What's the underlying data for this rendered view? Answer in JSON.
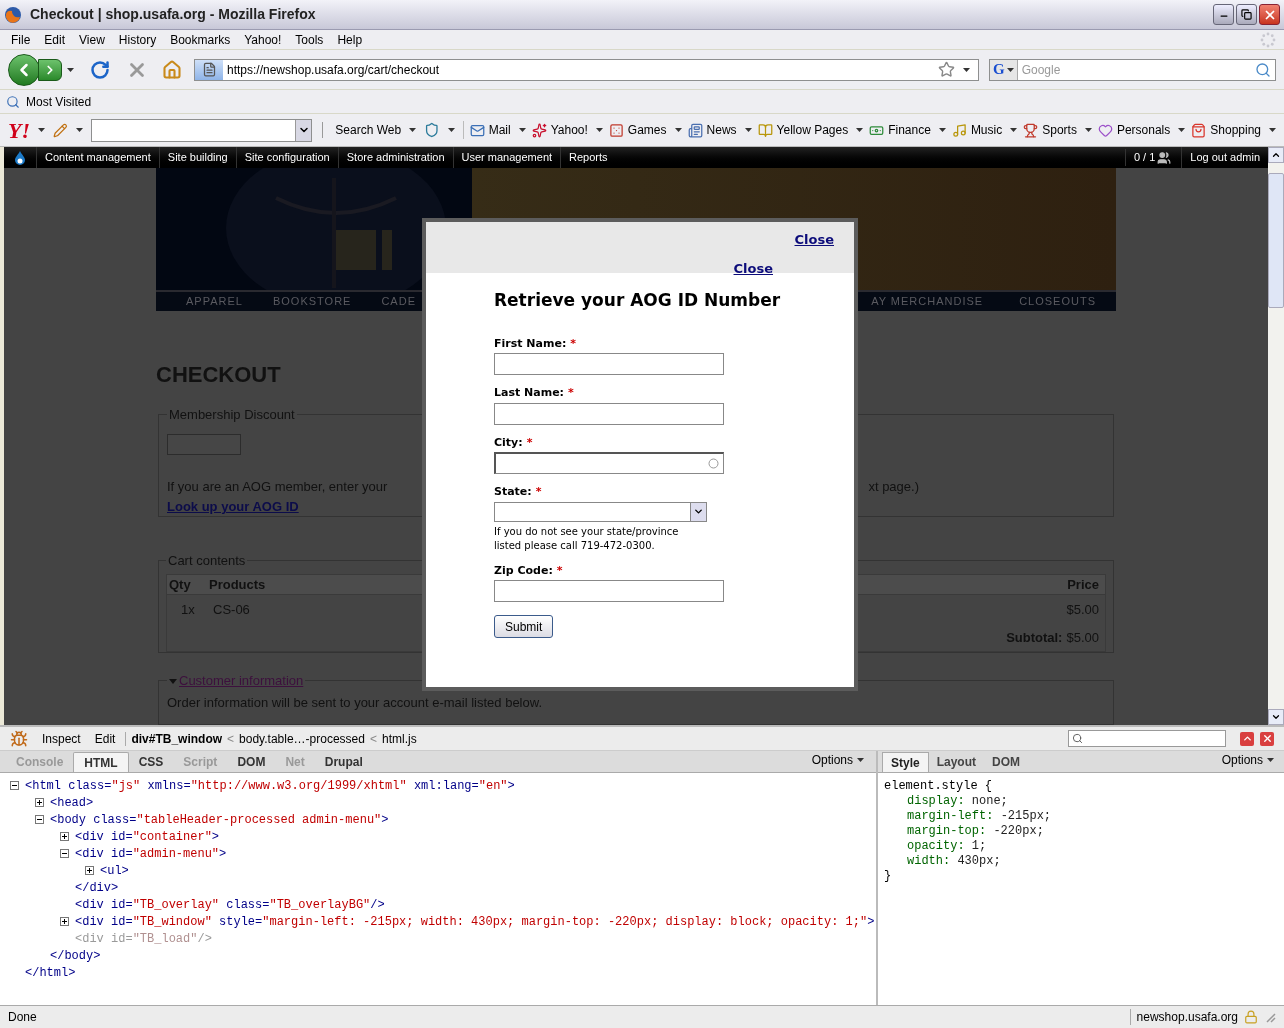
{
  "window": {
    "title": "Checkout | shop.usafa.org - Mozilla Firefox"
  },
  "menu_bar": [
    "File",
    "Edit",
    "View",
    "History",
    "Bookmarks",
    "Yahoo!",
    "Tools",
    "Help"
  ],
  "navigation": {
    "url": "https://newshop.usafa.org/cart/checkout",
    "search_engine_logo": "G",
    "search_placeholder": "Google"
  },
  "bookmarks_bar": [
    "Most Visited"
  ],
  "yahoo_toolbar": {
    "logo": "Y!",
    "items": [
      {
        "kind": "search",
        "label": "Search Web"
      },
      {
        "kind": "mail",
        "label": "Mail"
      },
      {
        "kind": "yahoo",
        "label": "Yahoo!"
      },
      {
        "kind": "games",
        "label": "Games"
      },
      {
        "kind": "news",
        "label": "News"
      },
      {
        "kind": "yellowpages",
        "label": "Yellow Pages"
      },
      {
        "kind": "finance",
        "label": "Finance"
      },
      {
        "kind": "music",
        "label": "Music"
      },
      {
        "kind": "sports",
        "label": "Sports"
      },
      {
        "kind": "personals",
        "label": "Personals"
      },
      {
        "kind": "shopping",
        "label": "Shopping"
      }
    ]
  },
  "admin_menu": {
    "items": [
      "Content management",
      "Site building",
      "Site configuration",
      "Store administration",
      "User management",
      "Reports"
    ],
    "user_count": "0 / 1",
    "logout": "Log out admin"
  },
  "page": {
    "nav_left": [
      "APPAREL",
      "BOOKSTORE",
      "CADE"
    ],
    "nav_right": [
      "AY MERCHANDISE",
      "CLOSEOUTS"
    ],
    "heading": "CHECKOUT",
    "membership": {
      "legend": "Membership Discount",
      "text_left": "If you are an AOG member, enter your",
      "text_right": "xt page.)",
      "link": "Look up your AOG ID"
    },
    "cart": {
      "legend": "Cart contents",
      "columns": [
        "Qty",
        "Products",
        "Price"
      ],
      "rows": [
        {
          "qty": "1x",
          "product": "CS-06",
          "price": "$5.00"
        }
      ],
      "subtotal_label": "Subtotal:",
      "subtotal_value": "$5.00"
    },
    "customer": {
      "legend": "Customer information",
      "expanded": true,
      "text": "Order information will be sent to your account e-mail listed below."
    }
  },
  "modal": {
    "close_links": [
      "Close",
      "Close"
    ],
    "title": "Retrieve your AOG ID Number",
    "fields": [
      {
        "kind": "text",
        "label": "First Name:",
        "required_mark": "*"
      },
      {
        "kind": "text",
        "label": "Last Name:",
        "required_mark": "*"
      },
      {
        "kind": "autocomplete",
        "label": "City:",
        "required_mark": "*"
      },
      {
        "kind": "select",
        "label": "State:",
        "required_mark": "*",
        "help_lines": [
          "If you do not see your state/province",
          "listed please call 719-472-0300."
        ]
      },
      {
        "kind": "text",
        "label": "Zip Code:",
        "required_mark": "*"
      }
    ],
    "submit": "Submit"
  },
  "firebug": {
    "tools": [
      "Inspect",
      "Edit"
    ],
    "breadcrumb": [
      {
        "text": "div#TB_window",
        "selected": true
      },
      {
        "separator": "<",
        "text": "body.table…-processed",
        "selected": false
      },
      {
        "separator": "<",
        "text": "html.js",
        "selected": false
      }
    ],
    "tabs": [
      {
        "label": "Console",
        "selected": false,
        "disabled": true
      },
      {
        "label": "HTML",
        "selected": true,
        "disabled": false
      },
      {
        "label": "CSS",
        "selected": false,
        "disabled": false
      },
      {
        "label": "Script",
        "selected": false,
        "disabled": true
      },
      {
        "label": "DOM",
        "selected": false,
        "disabled": false
      },
      {
        "label": "Net",
        "selected": false,
        "disabled": true
      },
      {
        "label": "Drupal",
        "selected": false,
        "disabled": false
      }
    ],
    "options": "Options",
    "html_tree": [
      {
        "open": "<html",
        "attrs": [
          {
            "name": "class=",
            "value": "\"js\""
          },
          {
            "name": "xmlns=",
            "value": "\"http://www.w3.org/1999/xhtml\""
          },
          {
            "name": "xml:lang=",
            "value": "\"en\""
          }
        ],
        "end": ">",
        "expanded": true,
        "hidden": false,
        "close": "</html>",
        "children": [
          {
            "open": "<head>",
            "expanded": false,
            "hidden": false
          },
          {
            "open": "<body",
            "attrs": [
              {
                "name": "class=",
                "value": "\"tableHeader-processed admin-menu\""
              }
            ],
            "end": ">",
            "expanded": true,
            "hidden": false,
            "close": "</body>",
            "children": [
              {
                "open": "<div",
                "attrs": [
                  {
                    "name": "id=",
                    "value": "\"container\""
                  }
                ],
                "end": ">",
                "expanded": false,
                "hidden": false
              },
              {
                "open": "<div",
                "attrs": [
                  {
                    "name": "id=",
                    "value": "\"admin-menu\""
                  }
                ],
                "end": ">",
                "expanded": true,
                "hidden": false,
                "close": "</div>",
                "children": [
                  {
                    "open": "<ul>",
                    "expanded": false,
                    "hidden": false
                  }
                ]
              },
              {
                "open": "<div",
                "attrs": [
                  {
                    "name": "id=",
                    "value": "\"TB_overlay\""
                  },
                  {
                    "name": "class=",
                    "value": "\"TB_overlayBG\""
                  }
                ],
                "end": "/>",
                "hidden": false
              },
              {
                "open": "<div",
                "attrs": [
                  {
                    "name": "id=",
                    "value": "\"TB_window\""
                  },
                  {
                    "name": "style=",
                    "value": "\"margin-left: -215px; width: 430px; margin-top: -220px; display: block; opacity: 1;\""
                  }
                ],
                "end": ">",
                "expanded": false,
                "hidden": false
              },
              {
                "open": "<div",
                "attrs": [
                  {
                    "name": "id=",
                    "value": "\"TB_load\""
                  }
                ],
                "end": "/>",
                "hidden": true
              }
            ]
          }
        ]
      }
    ],
    "side_tabs": [
      {
        "label": "Style",
        "selected": true
      },
      {
        "label": "Layout",
        "selected": false
      },
      {
        "label": "DOM",
        "selected": false
      }
    ],
    "side_options": "Options",
    "style_rule": {
      "selector": "element.style {",
      "declarations": [
        {
          "name": "display:",
          "value": "none;"
        },
        {
          "name": "margin-left:",
          "value": "-215px;"
        },
        {
          "name": "margin-top:",
          "value": "-220px;"
        },
        {
          "name": "opacity:",
          "value": "1;"
        },
        {
          "name": "width:",
          "value": "430px;"
        }
      ],
      "close": "}"
    }
  },
  "status_bar": {
    "text": "Done",
    "host": "newshop.usafa.org"
  }
}
